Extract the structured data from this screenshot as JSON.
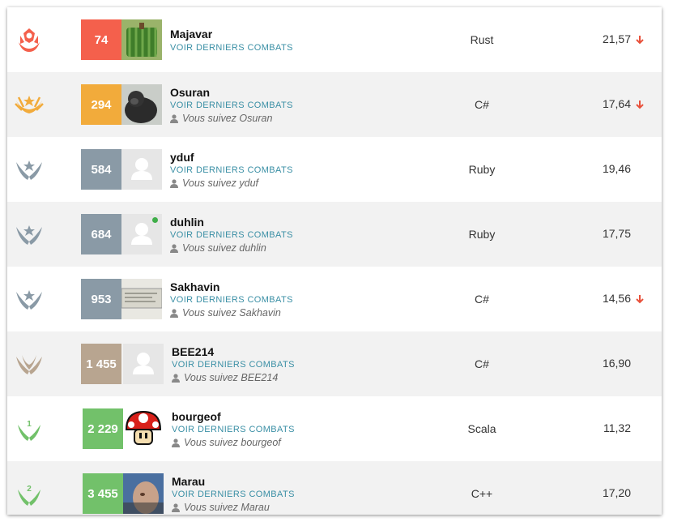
{
  "rows": [
    {
      "rank": "74",
      "name": "Majavar",
      "fights": "VOIR DERNIERS COMBATS",
      "follow": "",
      "lang": "Rust",
      "score": "21,57",
      "arrow": true,
      "rank_color": "#f4604c",
      "league": "legend",
      "avatar": "watermelon",
      "online": false
    },
    {
      "rank": "294",
      "name": "Osuran",
      "fights": "VOIR DERNIERS COMBATS",
      "follow": "Vous suivez Osuran",
      "lang": "C#",
      "score": "17,64",
      "arrow": true,
      "rank_color": "#f2ab3b",
      "league": "gold",
      "avatar": "gorilla",
      "online": false
    },
    {
      "rank": "584",
      "name": "yduf",
      "fights": "VOIR DERNIERS COMBATS",
      "follow": "Vous suivez yduf",
      "lang": "Ruby",
      "score": "19,46",
      "arrow": false,
      "rank_color": "#8a9aa6",
      "league": "silver",
      "avatar": "default",
      "online": false
    },
    {
      "rank": "684",
      "name": "duhlin",
      "fights": "VOIR DERNIERS COMBATS",
      "follow": "Vous suivez duhlin",
      "lang": "Ruby",
      "score": "17,75",
      "arrow": false,
      "rank_color": "#8a9aa6",
      "league": "silver",
      "avatar": "default",
      "online": true
    },
    {
      "rank": "953",
      "name": "Sakhavin",
      "fights": "VOIR DERNIERS COMBATS",
      "follow": "Vous suivez Sakhavin",
      "lang": "C#",
      "score": "14,56",
      "arrow": true,
      "rank_color": "#8a9aa6",
      "league": "silver",
      "avatar": "screenshot",
      "online": false
    },
    {
      "rank": "1 455",
      "name": "BEE214",
      "fights": "VOIR DERNIERS COMBATS",
      "follow": "Vous suivez BEE214",
      "lang": "C#",
      "score": "16,90",
      "arrow": false,
      "rank_color": "#b8a590",
      "league": "bronze",
      "avatar": "default",
      "online": false
    },
    {
      "rank": "2 229",
      "name": "bourgeof",
      "fights": "VOIR DERNIERS COMBATS",
      "follow": "Vous suivez bourgeof",
      "lang": "Scala",
      "score": "11,32",
      "arrow": false,
      "rank_color": "#72c16a",
      "league": "wood1",
      "avatar": "mushroom",
      "online": false
    },
    {
      "rank": "3 455",
      "name": "Marau",
      "fights": "VOIR DERNIERS COMBATS",
      "follow": "Vous suivez Marau",
      "lang": "C++",
      "score": "17,20",
      "arrow": false,
      "rank_color": "#72c16a",
      "league": "wood2",
      "avatar": "face",
      "online": false
    }
  ],
  "league_marks": {
    "wood1": "1",
    "wood2": "2"
  },
  "colors": {
    "down_arrow": "#e8503a",
    "link": "#3a8fa5",
    "legend": "#f4604c",
    "gold": "#f2ab3b",
    "silver": "#8a9aa6",
    "bronze": "#b8a590",
    "wood": "#72c16a"
  }
}
